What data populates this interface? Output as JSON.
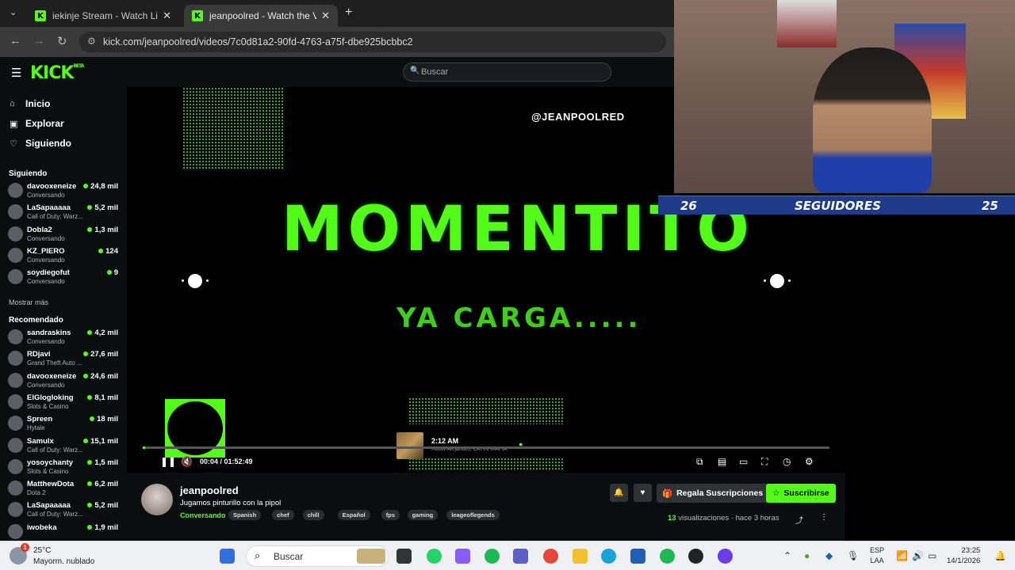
{
  "browser": {
    "tabs": [
      {
        "title": "iekinje Stream - Watch Live on Kick",
        "active": false
      },
      {
        "title": "jeanpoolred - Watch the VOD on Kick",
        "active": true
      }
    ],
    "new_tab": "+",
    "url": "kick.com/jeanpoolred/videos/7c0d81a2-90fd-4763-a75f-dbe925bcbbc2"
  },
  "kick": {
    "logo": "KICK",
    "logo_sup": "BETA",
    "search_placeholder": "Buscar",
    "accent": "#53fc18"
  },
  "sidebar": {
    "nav": [
      {
        "label": "Inicio",
        "icon": "home-icon"
      },
      {
        "label": "Explorar",
        "icon": "explore-icon"
      },
      {
        "label": "Siguiendo",
        "icon": "heart-icon"
      }
    ],
    "following_title": "Siguiendo",
    "following": [
      {
        "name": "davooxeneize",
        "category": "Conversando",
        "viewers": "24,8 mil"
      },
      {
        "name": "LaSapaaaaa",
        "category": "Call of Duty: Warz...",
        "viewers": "5,2 mil"
      },
      {
        "name": "Dobla2",
        "category": "Conversando",
        "viewers": "1,3 mil"
      },
      {
        "name": "KZ_PIERO",
        "category": "Conversando",
        "viewers": "124"
      },
      {
        "name": "soydiegofut",
        "category": "Conversando",
        "viewers": "9"
      }
    ],
    "show_more": "Mostrar más",
    "recommended_title": "Recomendado",
    "recommended": [
      {
        "name": "sandraskins",
        "category": "Conversando",
        "viewers": "4,2 mil"
      },
      {
        "name": "RDjavi",
        "category": "Grand Theft Auto ...",
        "viewers": "27,6 mil"
      },
      {
        "name": "davooxeneize",
        "category": "Conversando",
        "viewers": "24,6 mil"
      },
      {
        "name": "ElGlogloking",
        "category": "Slots & Casino",
        "viewers": "8,1 mil"
      },
      {
        "name": "Spreen",
        "category": "Hytale",
        "viewers": "18 mil"
      },
      {
        "name": "Samulx",
        "category": "Call of Duty: Warz...",
        "viewers": "15,1 mil"
      },
      {
        "name": "yosoychanty",
        "category": "Slots & Casino",
        "viewers": "1,5 mil"
      },
      {
        "name": "MatthewDota",
        "category": "Dota 2",
        "viewers": "6,2 mil"
      },
      {
        "name": "LaSapaaaaa",
        "category": "Call of Duty: Warz...",
        "viewers": "5,2 mil"
      },
      {
        "name": "iwobeka",
        "category": "",
        "viewers": "1,9 mil"
      }
    ]
  },
  "video": {
    "handle": "@JEANPOOLRED",
    "headline": "MOMENTITO",
    "subline": "YA CARGA.....",
    "now_playing_time": "2:12 AM",
    "now_playing_artist": "Rauw Alejandro, LATIN MAFIA",
    "time": "00:04 / 01:52:49",
    "progress": 0.001,
    "followers_left": "26",
    "followers_label": "SEGUIDORES",
    "followers_right": "25"
  },
  "info": {
    "streamer": "jeanpoolred",
    "title": "Jugamos pinturillo con la pipol",
    "category": "Conversando",
    "tags": [
      "Spanish",
      "chef",
      "chill",
      "Español",
      "fps",
      "gaming",
      "leageoflegends"
    ],
    "gift_label": "Regala Suscripciones",
    "subscribe_label": "Suscribirse",
    "views_count": "13",
    "views_label": "visualizaciones",
    "ago": "hace 3 horas"
  },
  "taskbar": {
    "weather_temp": "25°C",
    "weather_desc": "Mayorm. nublado",
    "weather_badge": "1",
    "search": "Buscar",
    "lang1": "ESP",
    "lang2": "LAA",
    "time": "23:25",
    "date": "14/1/2026"
  }
}
